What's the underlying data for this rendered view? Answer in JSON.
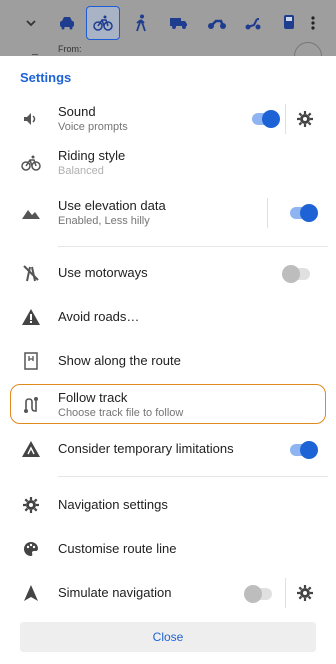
{
  "header": {
    "profiles": [
      "car-icon",
      "bicycle-icon",
      "pedestrian-icon",
      "truck-icon",
      "motorcycle-icon",
      "moped-icon",
      "public-transport-icon"
    ],
    "selected_profile": "bicycle-icon",
    "from_label": "From:"
  },
  "settings": {
    "title": "Settings",
    "sound": {
      "label": "Sound",
      "sub": "Voice prompts",
      "enabled": true
    },
    "riding_style": {
      "label": "Riding style",
      "sub": "Balanced"
    },
    "elevation": {
      "label": "Use elevation data",
      "sub": "Enabled, Less hilly",
      "enabled": true
    },
    "motorways": {
      "label": "Use motorways",
      "enabled": false
    },
    "avoid_roads": {
      "label": "Avoid roads…"
    },
    "show_along": {
      "label": "Show along the route"
    },
    "follow_track": {
      "label": "Follow track",
      "sub": "Choose track file to follow"
    },
    "temp_limits": {
      "label": "Consider temporary limitations",
      "enabled": true
    },
    "nav_settings": {
      "label": "Navigation settings"
    },
    "route_line": {
      "label": "Customise route line"
    },
    "simulate": {
      "label": "Simulate navigation",
      "enabled": false
    },
    "close": "Close"
  },
  "colors": {
    "accent": "#1e63d6",
    "highlight": "#e08a1e"
  }
}
